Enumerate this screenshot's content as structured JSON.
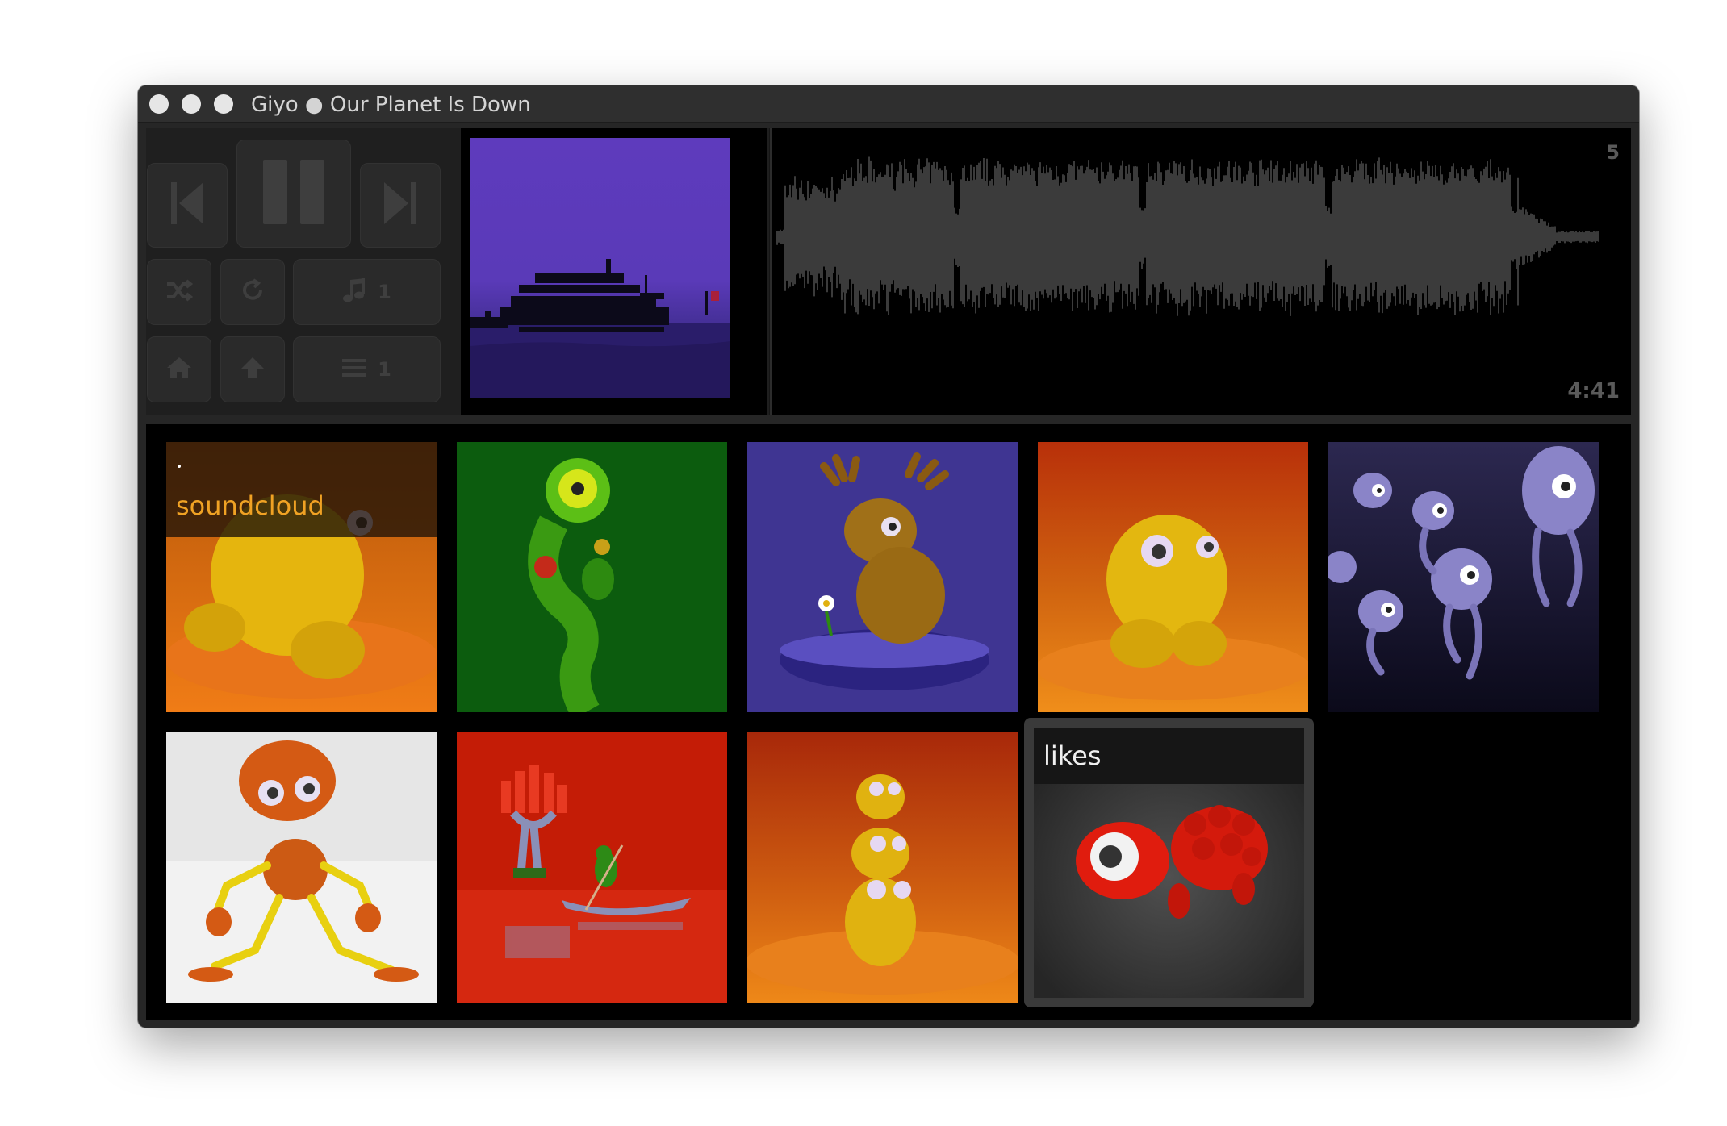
{
  "window": {
    "title": "Giyo ● Our Planet Is Down"
  },
  "player": {
    "buttons": {
      "previous": "previous-icon",
      "pause": "pause-icon",
      "next": "next-icon",
      "shuffle": "shuffle-icon",
      "repeat": "repeat-icon",
      "home": "home-icon",
      "up": "arrow-up-icon",
      "music": "music-note-icon",
      "list": "list-icon"
    },
    "music_count": "1",
    "list_count": "1"
  },
  "waveform": {
    "count": "5",
    "duration": "4:41"
  },
  "tiles": {
    "soundcloud_label": "soundcloud",
    "likes_label": "likes"
  },
  "colors": {
    "accent": "#f0a224",
    "background": "#000000",
    "panel": "#262626"
  }
}
